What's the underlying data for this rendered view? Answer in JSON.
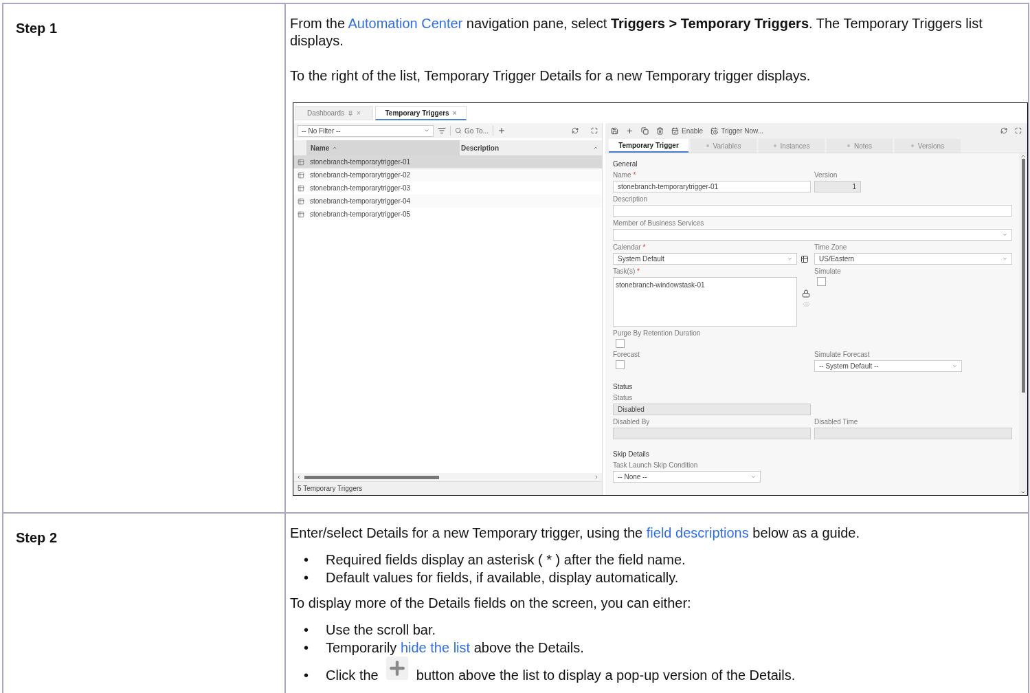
{
  "steps": [
    {
      "label": "Step 1",
      "blocks": [
        {
          "kind": "paragraph",
          "parts": [
            {
              "kind": "text",
              "text": "From the "
            },
            {
              "kind": "link",
              "text": "Automation Center"
            },
            {
              "kind": "text",
              "text": " navigation pane, select **Triggers > Temporary Triggers**. The Temporary Triggers list displays."
            }
          ]
        },
        {
          "kind": "paragraph",
          "parts": [
            {
              "kind": "text",
              "text": "To the right of the list, Temporary Trigger Details for a new Temporary trigger displays."
            }
          ]
        },
        {
          "kind": "screenshot",
          "app": {
            "tabs": [
              {
                "label": "Dashboards",
                "pinned": true,
                "close": "×",
                "selected": false
              },
              {
                "label": "Temporary Triggers",
                "pinned": false,
                "close": "×",
                "selected": true
              }
            ],
            "list": {
              "filter": "-- No Filter --",
              "goto": "Go To...",
              "columns": [
                "Name",
                "Description"
              ],
              "rows": [
                {
                  "name": "stonebranch-temporarytrigger-01",
                  "selected": true
                },
                {
                  "name": "stonebranch-temporarytrigger-02",
                  "selected": false
                },
                {
                  "name": "stonebranch-temporarytrigger-03",
                  "selected": false
                },
                {
                  "name": "stonebranch-temporarytrigger-04",
                  "selected": false
                },
                {
                  "name": "stonebranch-temporarytrigger-05",
                  "selected": false
                }
              ],
              "footer": "5 Temporary Triggers"
            },
            "details": {
              "actions": [
                {
                  "kind": "enable",
                  "label": "Enable"
                },
                {
                  "kind": "trigger",
                  "label": "Trigger Now..."
                }
              ],
              "tabs": [
                {
                  "label": "Temporary Trigger",
                  "selected": true
                },
                {
                  "label": "Variables",
                  "selected": false
                },
                {
                  "label": "Instances",
                  "selected": false
                },
                {
                  "label": "Notes",
                  "selected": false
                },
                {
                  "label": "Versions",
                  "selected": false
                }
              ],
              "sections": [
                {
                  "title": "General",
                  "rows": [
                    [
                      {
                        "kind": "text",
                        "label": "Name",
                        "required_mark": "*",
                        "value": "stonebranch-temporarytrigger-01"
                      },
                      {
                        "kind": "number",
                        "label": "Version",
                        "value": "1"
                      }
                    ],
                    [
                      {
                        "kind": "text",
                        "label": "Description"
                      }
                    ],
                    [
                      {
                        "kind": "select",
                        "label": "Member of Business Services"
                      }
                    ],
                    [
                      {
                        "kind": "calendar",
                        "label": "Calendar",
                        "required_mark": "*",
                        "value": "System Default"
                      },
                      {
                        "kind": "select",
                        "label": "Time Zone",
                        "value": "US/Eastern"
                      }
                    ],
                    [
                      {
                        "kind": "tasks",
                        "label": "Task(s)",
                        "required_mark": "*",
                        "value": "stonebranch-windowstask-01"
                      },
                      {
                        "kind": "checkbox",
                        "label": "Simulate",
                        "checked": false
                      }
                    ],
                    [
                      {
                        "kind": "checkbox",
                        "label": "Purge By Retention Duration",
                        "checked": false
                      }
                    ],
                    [
                      {
                        "kind": "checkbox",
                        "label": "Forecast",
                        "checked": false
                      },
                      {
                        "kind": "dropdown",
                        "label": "Simulate Forecast",
                        "value": "-- System Default --"
                      }
                    ]
                  ]
                },
                {
                  "title": "Status",
                  "rows": [
                    [
                      {
                        "kind": "readonly",
                        "label": "Status",
                        "value": "Disabled"
                      }
                    ],
                    [
                      {
                        "kind": "readonly",
                        "label": "Disabled By"
                      },
                      {
                        "kind": "readonly",
                        "label": "Disabled Time"
                      }
                    ]
                  ]
                },
                {
                  "title": "Skip Details",
                  "rows": [
                    [
                      {
                        "kind": "dropdown",
                        "label": "Task Launch Skip Condition",
                        "value": "-- None --"
                      }
                    ]
                  ]
                }
              ]
            }
          }
        }
      ]
    },
    {
      "label": "Step 2",
      "blocks": [
        {
          "kind": "paragraph",
          "parts": [
            {
              "kind": "text",
              "text": "Enter/select Details for a new Temporary trigger, using the "
            },
            {
              "kind": "link",
              "text": "field descriptions"
            },
            {
              "kind": "text",
              "text": " below as a guide."
            }
          ]
        },
        {
          "kind": "bullets",
          "items": [
            {
              "marker": "•",
              "parts": [
                {
                  "kind": "text",
                  "text": "Required fields display an asterisk ( * ) after the field name."
                }
              ]
            },
            {
              "marker": "•",
              "parts": [
                {
                  "kind": "text",
                  "text": "Default values for fields, if available, display automatically."
                }
              ]
            }
          ]
        },
        {
          "kind": "paragraph",
          "parts": [
            {
              "kind": "text",
              "text": "To display more of the Details fields on the screen, you can either:"
            }
          ]
        },
        {
          "kind": "bullets",
          "items": [
            {
              "marker": "•",
              "parts": [
                {
                  "kind": "text",
                  "text": "Use the scroll bar."
                }
              ]
            },
            {
              "marker": "•",
              "parts": [
                {
                  "kind": "text",
                  "text": "Temporarily "
                },
                {
                  "kind": "link",
                  "text": "hide the list"
                },
                {
                  "kind": "text",
                  "text": " above the Details."
                }
              ]
            },
            {
              "marker": "•",
              "parts": [
                {
                  "kind": "text",
                  "text": "Click the "
                },
                {
                  "kind": "icon"
                },
                {
                  "kind": "text",
                  "text": " button above the list to display a pop-up version of the Details."
                }
              ]
            }
          ]
        }
      ]
    }
  ]
}
